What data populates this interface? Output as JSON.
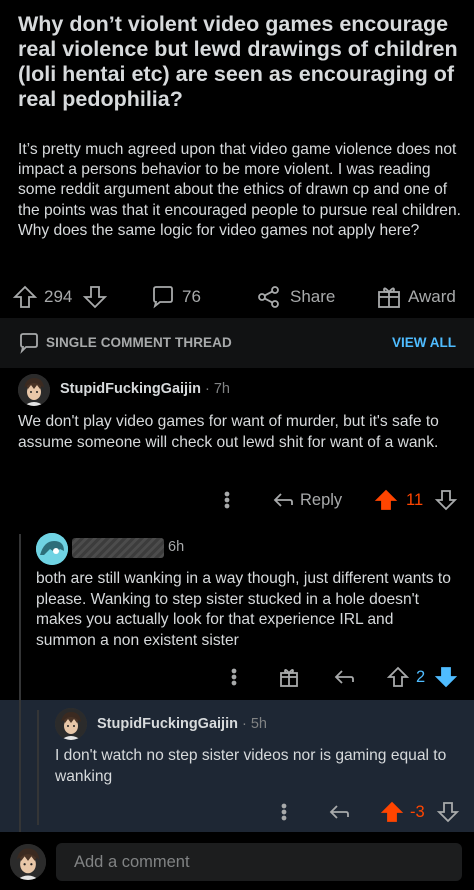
{
  "post": {
    "title": "Why don’t violent video games encourage real violence but lewd drawings of children (loli hentai etc) are seen as encouraging of real pedophilia?",
    "body": "It’s pretty much agreed upon that video game violence does not impact a persons behavior to be more violent. I was reading some reddit argument about the ethics of drawn cp and one of the points was that it encouraged people to pursue real children. Why does the same logic for video games not apply here?",
    "votes": "294",
    "comments": "76",
    "share_label": "Share",
    "award_label": "Award"
  },
  "thread_bar": {
    "label": "SINGLE COMMENT THREAD",
    "view_all": "VIEW ALL"
  },
  "comments": [
    {
      "author": "StupidFuckingGaijin",
      "age": "· 7h",
      "text": "We don't play video games for want of murder, but it's safe to assume someone will check out lewd shit for want of a wank.",
      "reply_label": "Reply",
      "score": "11"
    },
    {
      "author": "",
      "age": "6h",
      "text": "both are still wanking in a way though, just different wants to please. Wanking to step sister stucked in a hole doesn't makes you actually look for that experience IRL and summon a non existent sister",
      "score": "2"
    },
    {
      "author": "StupidFuckingGaijin",
      "age": "· 5h",
      "text": "I don't watch no step sister videos nor is gaming equal to wanking",
      "score": "-3"
    }
  ],
  "footer": {
    "placeholder": "Add a comment"
  },
  "colors": {
    "upvote": "#ff4500",
    "downvote": "#4fbcff",
    "highlight_bg": "#1e2734",
    "link": "#4fbcff"
  }
}
